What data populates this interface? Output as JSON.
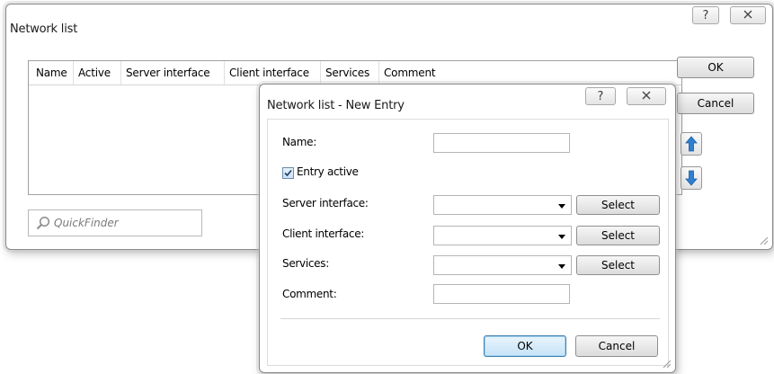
{
  "main_window": {
    "title": "Network list",
    "help_glyph": "?",
    "close_glyph": "X",
    "columns": [
      "Name",
      "Active",
      "Server interface",
      "Client interface",
      "Services",
      "Comment"
    ],
    "ok_label": "OK",
    "cancel_label": "Cancel",
    "quickfinder_placeholder": "QuickFinder"
  },
  "dialog": {
    "title": "Network list - New Entry",
    "help_glyph": "?",
    "close_glyph": "X",
    "name_label": "Name:",
    "name_value": "",
    "entry_active_label": "Entry active",
    "entry_active_checked": true,
    "server_interface_label": "Server interface:",
    "server_interface_value": "",
    "client_interface_label": "Client interface:",
    "client_interface_value": "",
    "services_label": "Services:",
    "services_value": "",
    "comment_label": "Comment:",
    "comment_value": "",
    "select_label": "Select",
    "ok_label": "OK",
    "cancel_label": "Cancel"
  },
  "colors": {
    "arrow_blue": "#2f7fd0",
    "default_button_border": "#3c7fb1"
  }
}
